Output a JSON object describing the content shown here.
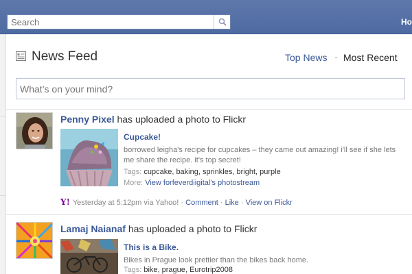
{
  "header": {
    "search_placeholder": "Search",
    "home_label": "Ho"
  },
  "feed": {
    "title": "News Feed",
    "tab_top": "Top News",
    "tab_separator": "·",
    "tab_recent": "Most Recent",
    "status_placeholder": "What’s on your mind?"
  },
  "stories": [
    {
      "actor": "Penny Pixel",
      "action": " has uploaded a photo to Flickr",
      "photo_title": "Cupcake!",
      "caption": "borrowed leigha's recipe for cupcakes – they came out amazing! i'll see if she lets me share the recipe. it's top secret!",
      "tags_label": "Tags: ",
      "tags": "cupcake, baking, sprinkles, bright, purple",
      "more_label": "More: ",
      "more_link": "View forfeverdiigital's photostream",
      "footer": {
        "source": "Yesterday at 5:12pm via Yahoo!",
        "comment": "Comment",
        "like": "Like",
        "view": "View on Flickr",
        "dot": " · "
      }
    },
    {
      "actor": "Lamaj Naianaf",
      "action": " has uploaded a photo to Flickr",
      "photo_title": "This is a Bike.",
      "caption": "Bikes in Prague look prettier than the bikes back home.",
      "tags_label": "Tags: ",
      "tags": "bike, prague, Eurotrip2008"
    }
  ],
  "colors": {
    "topbar": "#4d6aa1",
    "link": "#3b5998",
    "yahoo": "#7b0099"
  },
  "icons": {
    "search": "magnifier-icon",
    "feed": "news-feed-icon",
    "yahoo": "yahoo-y-icon"
  }
}
